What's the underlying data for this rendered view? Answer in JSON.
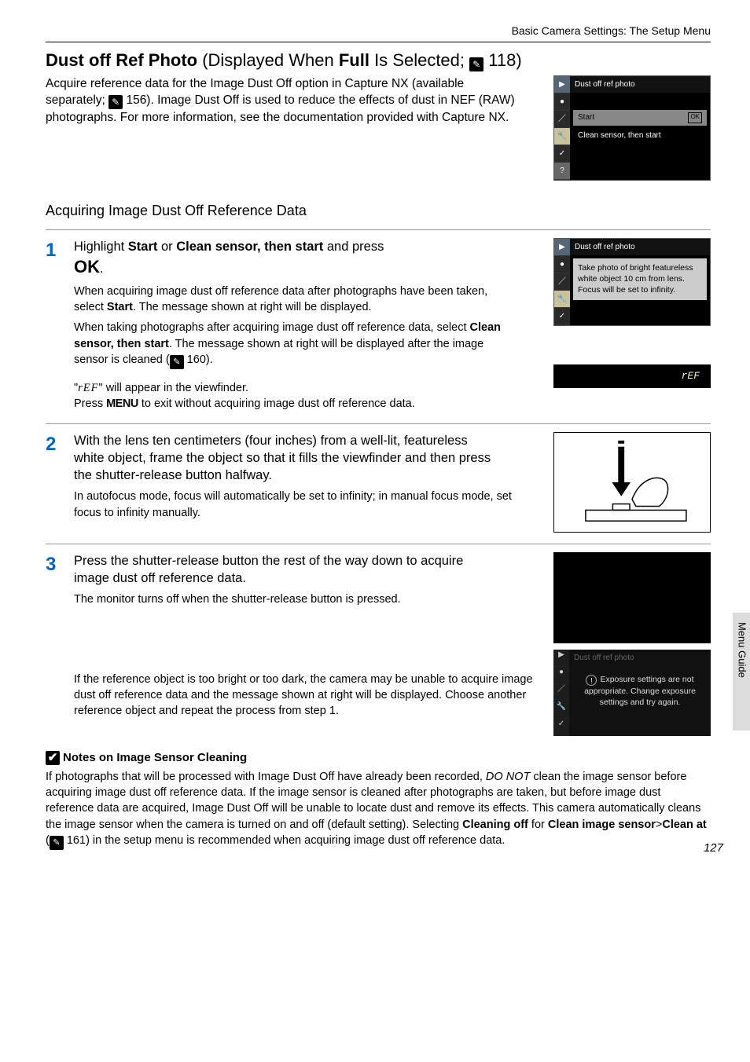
{
  "header": {
    "breadcrumb": "Basic Camera Settings: The Setup Menu"
  },
  "title": {
    "main": "Dust off Ref Photo",
    "paren_pre": " (Displayed When ",
    "paren_bold": "Full",
    "paren_post": " Is Selected; ",
    "ref": " 118)"
  },
  "intro": {
    "p1a": "Acquire reference data for the Image Dust Off option in Capture NX (available separately; ",
    "p1b": " 156). Image Dust Off is used to reduce the effects of dust in NEF (RAW) photographs. For more information, see the documentation provided with Capture NX."
  },
  "menu1": {
    "title": "Dust off ref photo",
    "item1": "Start",
    "ok": "OK",
    "item2": "Clean sensor, then start"
  },
  "subhead": "Acquiring Image Dust Off Reference Data",
  "step1": {
    "num": "1",
    "head_a": "Highlight ",
    "head_b": "Start",
    "head_c": " or ",
    "head_d": "Clean sensor, then start",
    "head_e": " and press ",
    "head_f": "OK",
    "head_g": ".",
    "p1a": "When acquiring image dust off reference data after photographs have been taken, select ",
    "p1b": "Start",
    "p1c": ". The message shown at right will be displayed.",
    "p2a": "When taking photographs after acquiring image dust off reference data, select ",
    "p2b": "Clean sensor, then start",
    "p2c": ". The message shown at right will be displayed after the image sensor is cleaned (",
    "p2d": " 160).",
    "p3a": "\"",
    "p3sym": "rEF",
    "p3b": "\" will appear in the viewfinder.",
    "p4a": "Press ",
    "p4menu": "MENU",
    "p4b": " to exit without acquiring image dust off reference data."
  },
  "menu2": {
    "title": "Dust off ref photo",
    "msg": "Take photo of bright featureless white object 10 cm from lens. Focus will be set to infinity."
  },
  "viewfinder": {
    "text": "rEF"
  },
  "step2": {
    "num": "2",
    "head": "With the lens ten centimeters (four inches) from a well-lit, featureless white object, frame the object so that it fills the viewfinder and then press the shutter-release button halfway.",
    "p1": "In autofocus mode, focus will automatically be set to infinity; in manual focus mode, set focus to infinity manually."
  },
  "step3": {
    "num": "3",
    "head": "Press the shutter-release button the rest of the way down to acquire image dust off reference data.",
    "p1": "The monitor turns off when the shutter-release button is pressed.",
    "p2": "If the reference object is too bright or too dark, the camera may be unable to acquire image dust off reference data and the message shown at right will be displayed. Choose another reference object and repeat the process from step 1."
  },
  "error": {
    "title": "Dust off ref photo",
    "msg": "Exposure settings are not appropriate. Change exposure settings and try again."
  },
  "notes": {
    "head": "Notes on Image Sensor Cleaning",
    "body_a": "If photographs that will be processed with Image Dust Off have already been recorded, ",
    "body_i": "DO NOT",
    "body_b": " clean the image sensor before acquiring image dust off reference data. If the image sensor is cleaned after photographs are taken, but before image dust reference data are acquired, Image Dust Off will be unable to locate dust and remove its effects. This camera automatically cleans the image sensor when the camera is turned on and off (default setting). Selecting ",
    "body_c": "Cleaning off",
    "body_d": " for ",
    "body_e": "Clean image sensor",
    "body_f": ">",
    "body_g": "Clean at",
    "body_h": " (",
    "body_j": " 161) in the setup menu is recommended when acquiring image dust off reference data."
  },
  "sidetab": "Menu Guide",
  "pagenum": "127"
}
